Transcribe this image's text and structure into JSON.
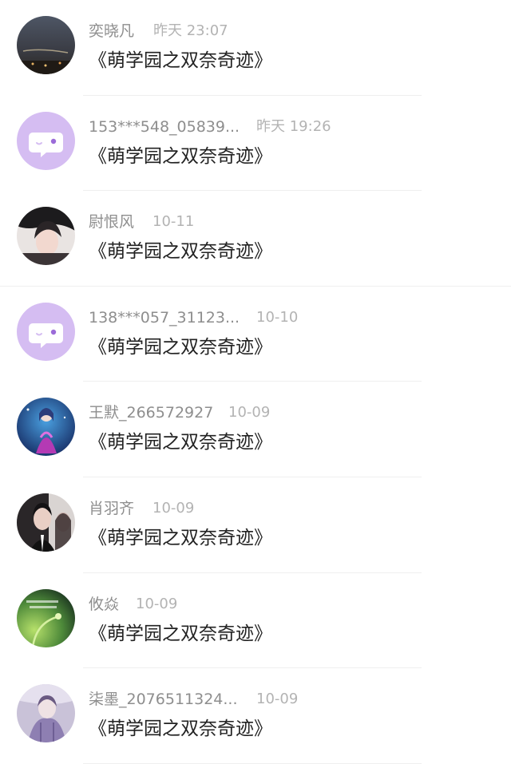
{
  "comments": [
    {
      "name": "奕晓凡",
      "time": "昨天 23:07",
      "text": "《萌学园之双奈奇迹》",
      "avatar": "night-sky-photo"
    },
    {
      "name": "153***548_05839...",
      "time": "昨天 19:26",
      "text": "《萌学园之双奈奇迹》",
      "avatar": "default-chat-avatar"
    },
    {
      "name": "尉恨风",
      "time": "10-11",
      "text": "《萌学园之双奈奇迹》",
      "avatar": "portrait-photo"
    },
    {
      "name": "138***057_31123...",
      "time": "10-10",
      "text": "《萌学园之双奈奇迹》",
      "avatar": "default-chat-avatar"
    },
    {
      "name": "王默_266572927",
      "time": "10-09",
      "text": "《萌学园之双奈奇迹》",
      "avatar": "anime-character-photo"
    },
    {
      "name": "肖羽齐",
      "time": "10-09",
      "text": "《萌学园之双奈奇迹》",
      "avatar": "portrait-photo"
    },
    {
      "name": "攸焱",
      "time": "10-09",
      "text": "《萌学园之双奈奇迹》",
      "avatar": "green-plant-photo"
    },
    {
      "name": "柒墨_2076511324...",
      "time": "10-09",
      "text": "《萌学园之双奈奇迹》",
      "avatar": "portrait-photo"
    }
  ],
  "colors": {
    "default_avatar_bg": "#d5bdf2",
    "name_text": "#8e8e8e",
    "time_text": "#b3b3b3",
    "body_text": "#222222"
  }
}
